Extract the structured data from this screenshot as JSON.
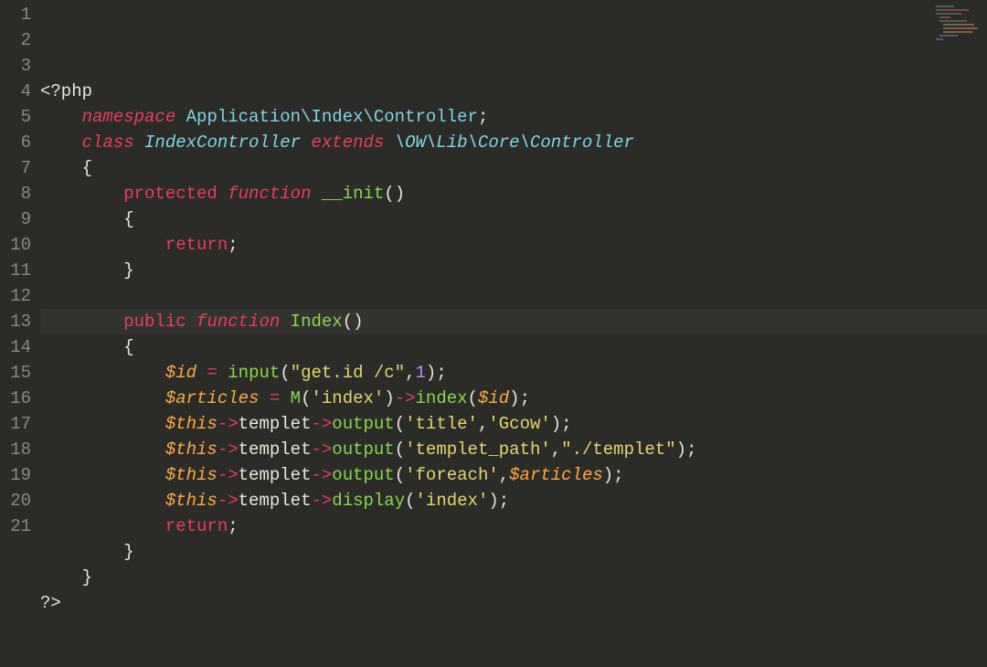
{
  "highlight_line_index": 12,
  "lines": [
    {
      "n": 1,
      "tokens": [
        [
          "tk-tag",
          "<?php"
        ]
      ]
    },
    {
      "n": 2,
      "tokens": [
        [
          "",
          "    "
        ],
        [
          "tk-kw",
          "namespace"
        ],
        [
          "",
          " "
        ],
        [
          "tk-type",
          "Application\\Index\\Controller"
        ],
        [
          "tk-punc",
          ";"
        ]
      ]
    },
    {
      "n": 3,
      "tokens": [
        [
          "",
          "    "
        ],
        [
          "tk-kw",
          "class"
        ],
        [
          "",
          " "
        ],
        [
          "tk-class",
          "IndexController"
        ],
        [
          "",
          " "
        ],
        [
          "tk-kw",
          "extends"
        ],
        [
          "",
          " "
        ],
        [
          "tk-class",
          "\\OW\\Lib\\Core\\Controller"
        ]
      ]
    },
    {
      "n": 4,
      "tokens": [
        [
          "",
          "    "
        ],
        [
          "tk-punc",
          "{"
        ]
      ]
    },
    {
      "n": 5,
      "tokens": [
        [
          "",
          "        "
        ],
        [
          "tk-kw2",
          "protected"
        ],
        [
          "",
          " "
        ],
        [
          "tk-kw",
          "function"
        ],
        [
          "",
          " "
        ],
        [
          "tk-funcdef",
          "__init"
        ],
        [
          "tk-punc",
          "()"
        ]
      ]
    },
    {
      "n": 6,
      "tokens": [
        [
          "",
          "        "
        ],
        [
          "tk-punc",
          "{"
        ]
      ]
    },
    {
      "n": 7,
      "tokens": [
        [
          "",
          "            "
        ],
        [
          "tk-kw2",
          "return"
        ],
        [
          "tk-punc",
          ";"
        ]
      ]
    },
    {
      "n": 8,
      "tokens": [
        [
          "",
          "        "
        ],
        [
          "tk-punc",
          "}"
        ]
      ]
    },
    {
      "n": 9,
      "tokens": [
        [
          "",
          ""
        ]
      ]
    },
    {
      "n": 10,
      "tokens": [
        [
          "",
          "        "
        ],
        [
          "tk-kw2",
          "public"
        ],
        [
          "",
          " "
        ],
        [
          "tk-kw",
          "function"
        ],
        [
          "",
          " "
        ],
        [
          "tk-funcdef",
          "Index"
        ],
        [
          "tk-punc",
          "()"
        ]
      ]
    },
    {
      "n": 11,
      "tokens": [
        [
          "",
          "        "
        ],
        [
          "tk-punc",
          "{"
        ]
      ]
    },
    {
      "n": 12,
      "tokens": [
        [
          "",
          "            "
        ],
        [
          "tk-var",
          "$id"
        ],
        [
          "",
          " "
        ],
        [
          "tk-op",
          "="
        ],
        [
          "",
          " "
        ],
        [
          "tk-func",
          "input"
        ],
        [
          "tk-punc",
          "("
        ],
        [
          "tk-str",
          "\"get.id /c\""
        ],
        [
          "tk-punc",
          ","
        ],
        [
          "tk-num",
          "1"
        ],
        [
          "tk-punc",
          ");"
        ]
      ]
    },
    {
      "n": 13,
      "tokens": [
        [
          "",
          "            "
        ],
        [
          "tk-var",
          "$articles"
        ],
        [
          "",
          " "
        ],
        [
          "tk-op",
          "="
        ],
        [
          "",
          " "
        ],
        [
          "tk-func",
          "M"
        ],
        [
          "tk-punc",
          "("
        ],
        [
          "tk-str",
          "'index'"
        ],
        [
          "tk-punc",
          ")"
        ],
        [
          "tk-op",
          "->"
        ],
        [
          "tk-func",
          "index"
        ],
        [
          "tk-punc",
          "("
        ],
        [
          "tk-var",
          "$id"
        ],
        [
          "tk-punc",
          ");"
        ]
      ]
    },
    {
      "n": 14,
      "tokens": [
        [
          "",
          "            "
        ],
        [
          "tk-this",
          "$this"
        ],
        [
          "tk-op",
          "->"
        ],
        [
          "tk-prop",
          "templet"
        ],
        [
          "tk-op",
          "->"
        ],
        [
          "tk-func",
          "output"
        ],
        [
          "tk-punc",
          "("
        ],
        [
          "tk-str",
          "'title'"
        ],
        [
          "tk-punc",
          ","
        ],
        [
          "tk-str",
          "'Gcow'"
        ],
        [
          "tk-punc",
          ");"
        ]
      ]
    },
    {
      "n": 15,
      "tokens": [
        [
          "",
          "            "
        ],
        [
          "tk-this",
          "$this"
        ],
        [
          "tk-op",
          "->"
        ],
        [
          "tk-prop",
          "templet"
        ],
        [
          "tk-op",
          "->"
        ],
        [
          "tk-func",
          "output"
        ],
        [
          "tk-punc",
          "("
        ],
        [
          "tk-str",
          "'templet_path'"
        ],
        [
          "tk-punc",
          ","
        ],
        [
          "tk-str",
          "\"./templet\""
        ],
        [
          "tk-punc",
          ");"
        ]
      ]
    },
    {
      "n": 16,
      "tokens": [
        [
          "",
          "            "
        ],
        [
          "tk-this",
          "$this"
        ],
        [
          "tk-op",
          "->"
        ],
        [
          "tk-prop",
          "templet"
        ],
        [
          "tk-op",
          "->"
        ],
        [
          "tk-func",
          "output"
        ],
        [
          "tk-punc",
          "("
        ],
        [
          "tk-str",
          "'foreach'"
        ],
        [
          "tk-punc",
          ","
        ],
        [
          "tk-var",
          "$articles"
        ],
        [
          "tk-punc",
          ");"
        ]
      ]
    },
    {
      "n": 17,
      "tokens": [
        [
          "",
          "            "
        ],
        [
          "tk-this",
          "$this"
        ],
        [
          "tk-op",
          "->"
        ],
        [
          "tk-prop",
          "templet"
        ],
        [
          "tk-op",
          "->"
        ],
        [
          "tk-func",
          "display"
        ],
        [
          "tk-punc",
          "("
        ],
        [
          "tk-str",
          "'index'"
        ],
        [
          "tk-punc",
          ");"
        ]
      ]
    },
    {
      "n": 18,
      "tokens": [
        [
          "",
          "            "
        ],
        [
          "tk-kw2",
          "return"
        ],
        [
          "tk-punc",
          ";"
        ]
      ]
    },
    {
      "n": 19,
      "tokens": [
        [
          "",
          "        "
        ],
        [
          "tk-punc",
          "}"
        ]
      ]
    },
    {
      "n": 20,
      "tokens": [
        [
          "",
          "    "
        ],
        [
          "tk-punc",
          "}"
        ]
      ]
    },
    {
      "n": 21,
      "tokens": [
        [
          "tk-tag",
          "?>"
        ]
      ]
    }
  ]
}
